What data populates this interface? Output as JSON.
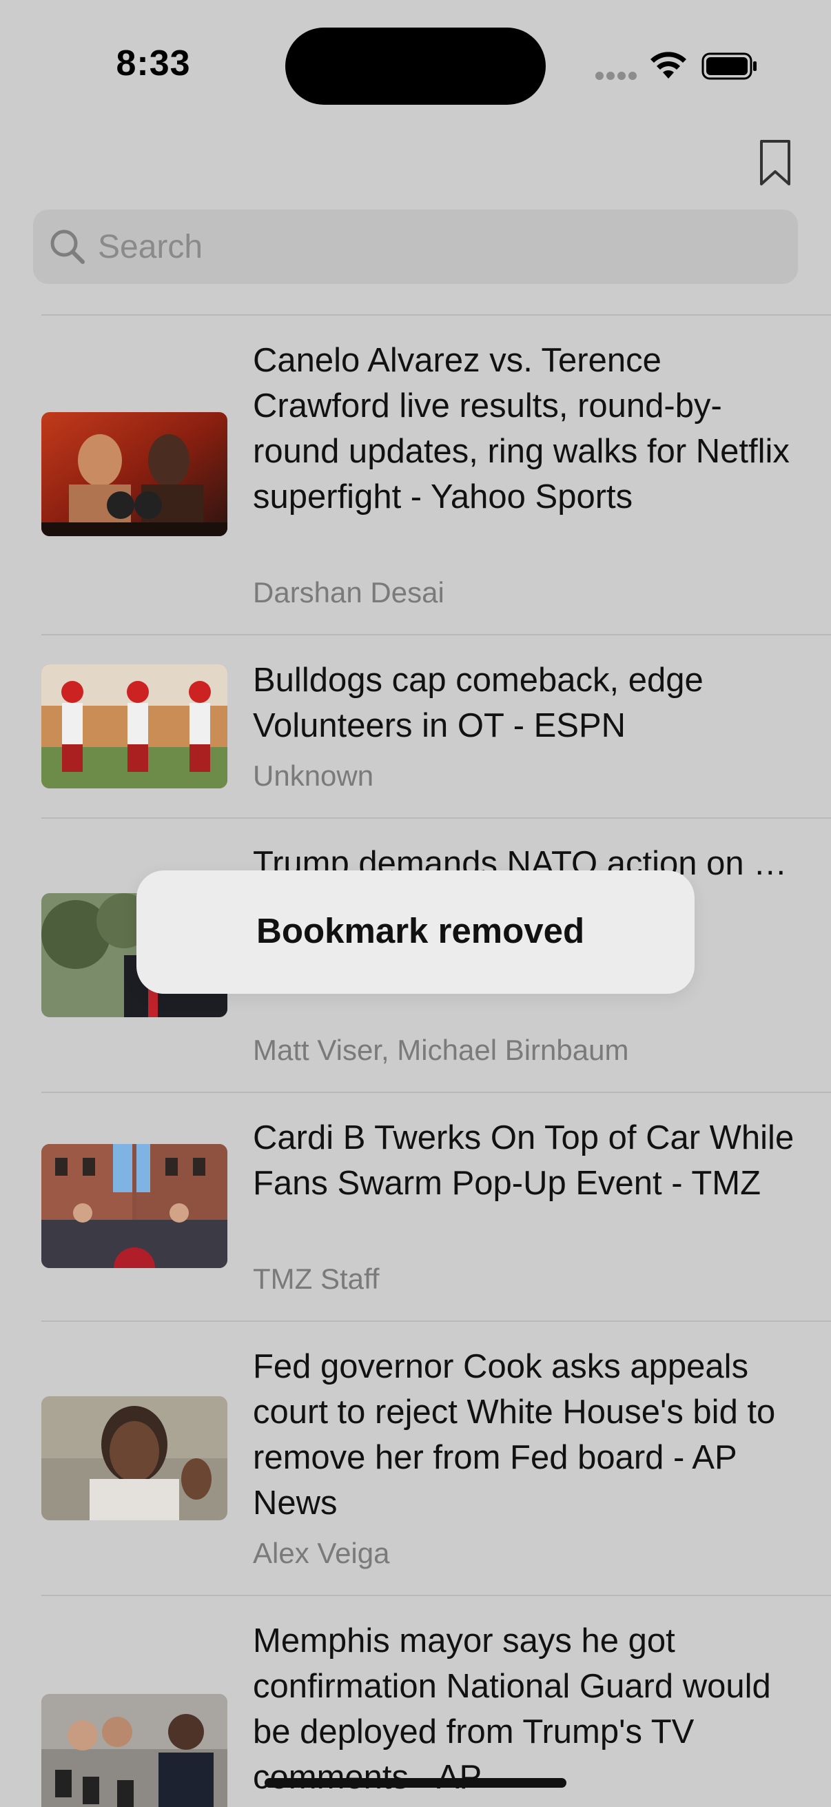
{
  "status_bar": {
    "time": "8:33"
  },
  "toolbar": {
    "bookmarks_icon": "bookmark-icon"
  },
  "search": {
    "placeholder": "Search",
    "value": ""
  },
  "articles": [
    {
      "title": "Canelo Alvarez vs. Terence Crawford live results, round-by-round updates, ring walks for Netflix superfight - Yahoo Sports",
      "author": "Darshan Desai"
    },
    {
      "title": "Bulldogs cap comeback, edge Volunteers in OT - ESPN",
      "author": "Unknown"
    },
    {
      "title": "Trump demands NATO action on … Post",
      "author": "Matt Viser, Michael Birnbaum"
    },
    {
      "title": "Cardi B Twerks On Top of Car While Fans Swarm Pop-Up Event - TMZ",
      "author": "TMZ Staff"
    },
    {
      "title": "Fed governor Cook asks appeals court to reject White House's bid to remove her from Fed board - AP News",
      "author": "Alex Veiga"
    },
    {
      "title": "Memphis mayor says he got confirmation National Guard would be deployed from Trump's TV comments - AP",
      "author": ""
    }
  ],
  "toast": {
    "message": "Bookmark removed"
  },
  "colors": {
    "background": "#cccccc",
    "search_field": "#c0c0c0",
    "toast": "#ececec",
    "secondary_text": "#7a7a7a"
  }
}
